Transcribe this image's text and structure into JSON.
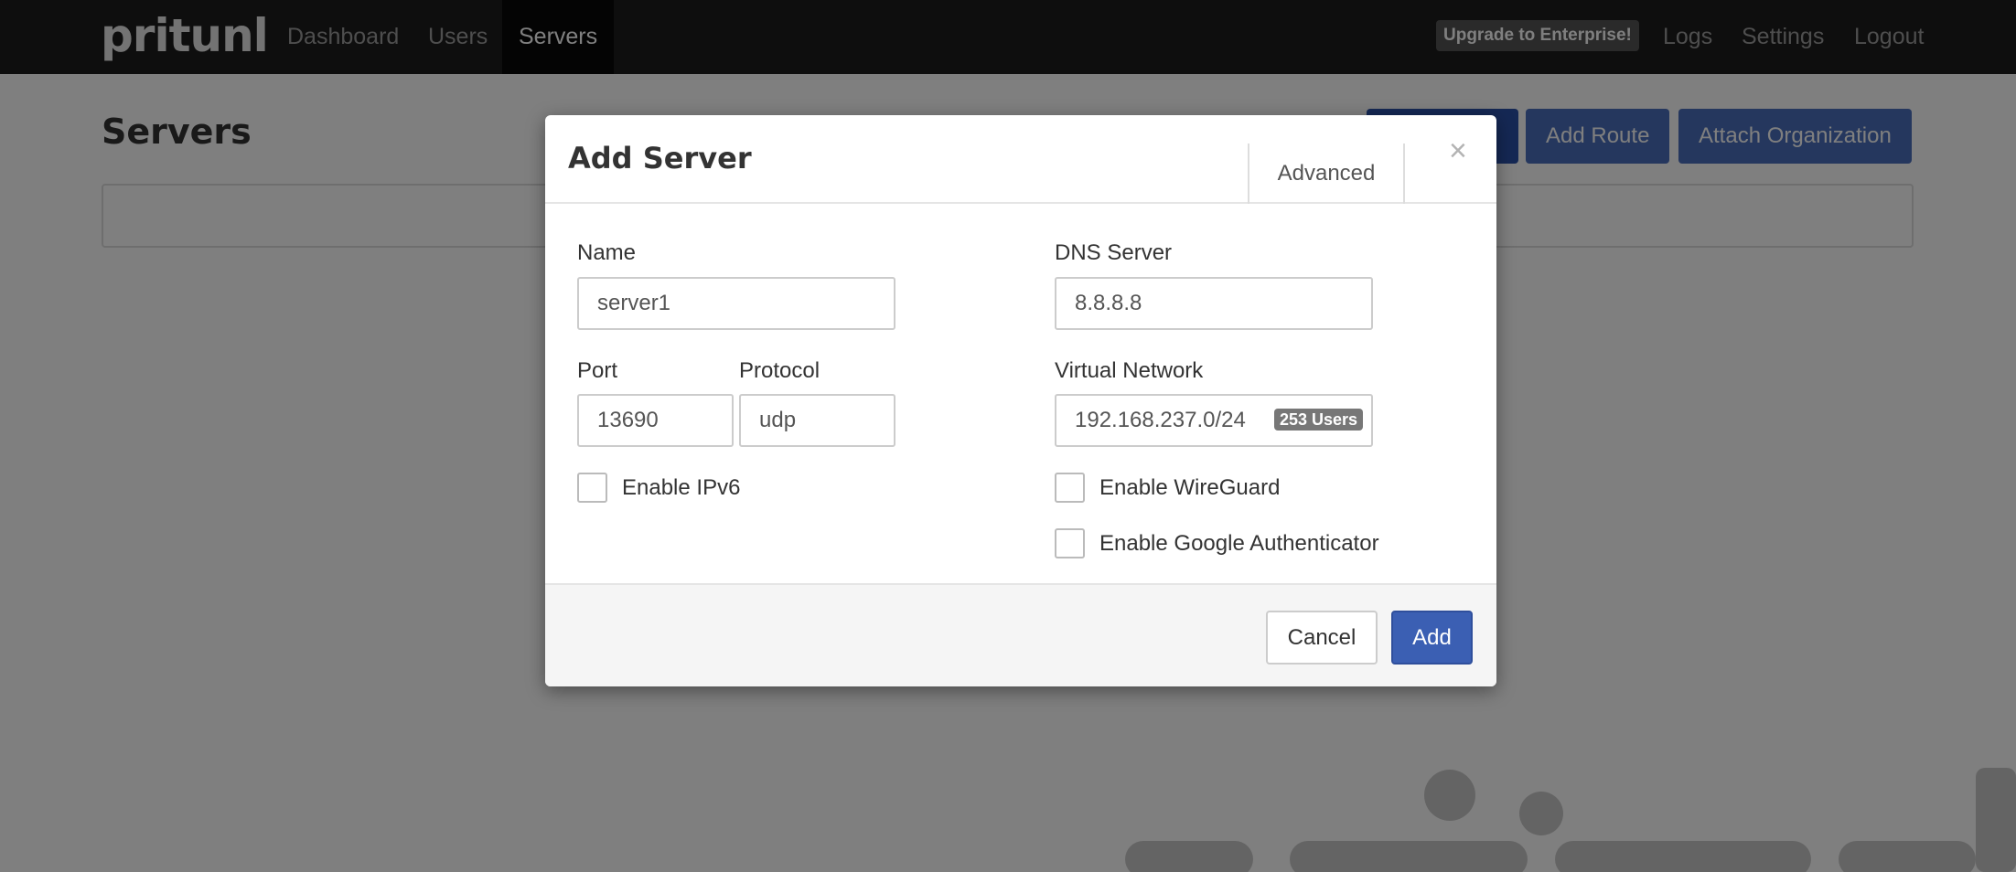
{
  "navbar": {
    "brand": "pritunl",
    "links": [
      "Dashboard",
      "Users",
      "Servers"
    ],
    "active": "Servers",
    "upgrade_label": "Upgrade to Enterprise!",
    "right_links": [
      "Logs",
      "Settings",
      "Logout"
    ]
  },
  "page": {
    "title": "Servers",
    "buttons": [
      "Add Route",
      "Attach Organization"
    ]
  },
  "modal": {
    "title": "Add Server",
    "advanced_label": "Advanced",
    "close_glyph": "×",
    "name": {
      "label": "Name",
      "value": "server1"
    },
    "port": {
      "label": "Port",
      "value": "13690"
    },
    "protocol": {
      "label": "Protocol",
      "value": "udp"
    },
    "dns": {
      "label": "DNS Server",
      "value": "8.8.8.8"
    },
    "network": {
      "label": "Virtual Network",
      "value": "192.168.237.0/24",
      "badge": "253 Users"
    },
    "checkboxes": {
      "ipv6": {
        "label": "Enable IPv6",
        "checked": false
      },
      "wireguard": {
        "label": "Enable WireGuard",
        "checked": false
      },
      "google_auth": {
        "label": "Enable Google Authenticator",
        "checked": false
      }
    },
    "cancel_label": "Cancel",
    "add_label": "Add"
  },
  "colors": {
    "navbar": "#1c1c1c",
    "primary": "#3b5fb3",
    "badge": "#777777"
  }
}
